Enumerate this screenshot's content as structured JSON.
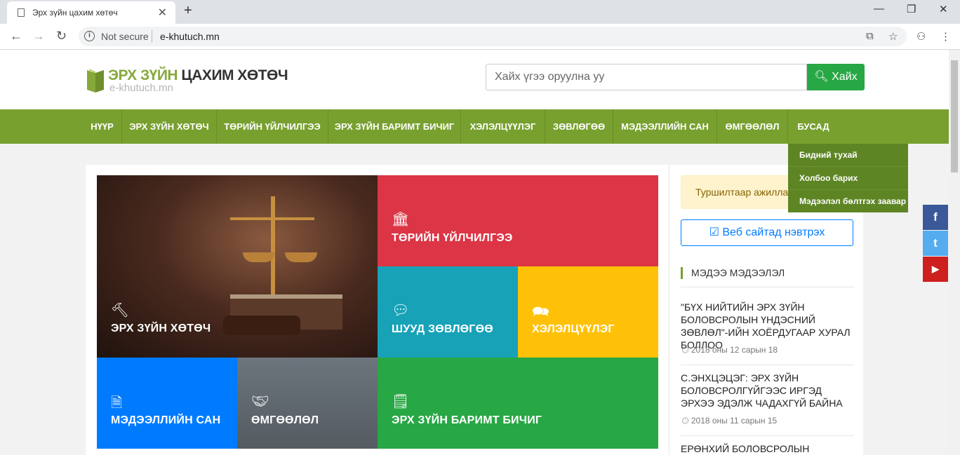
{
  "browser": {
    "tab_title": "Эрх зүйн цахим хөтөч",
    "tab_close": "✕",
    "new_tab": "+",
    "security": "Not secure",
    "url": "e-khutuch.mn",
    "minimize": "—",
    "maximize": "❐",
    "close": "✕"
  },
  "header": {
    "logo_green": "ЭРХ ЗҮЙН",
    "logo_dark": " ЦАХИМ ХӨТӨЧ",
    "logo_sub": "e-khutuch.mn",
    "search_placeholder": "Хайх үгээ оруулна уу",
    "search_button": "Хайх"
  },
  "nav": {
    "items": [
      "НҮҮР",
      "ЭРХ ЗҮЙН ХӨТӨЧ",
      "ТӨРИЙН ҮЙЛЧИЛГЭЭ",
      "ЭРХ ЗҮЙН БАРИМТ БИЧИГ",
      "ХЭЛЭЛЦҮҮЛЭГ",
      "ЗӨВЛӨГӨӨ",
      "МЭДЭЭЛЛИЙН САН",
      "ӨМГӨӨЛӨЛ",
      "БУСАД"
    ],
    "dropdown": [
      "Бидний тухай",
      "Холбоо барих",
      "Мэдээлэл бөлтгэх заавар"
    ]
  },
  "tiles": {
    "law": "ЭРХ ЗҮЙН ХӨТӨЧ",
    "state": "ТӨРИЙН ҮЙЛЧИЛГЭЭ",
    "consult": "ШУУД ЗӨВЛӨГӨӨ",
    "discuss": "ХЭЛЭЛЦҮҮЛЭГ",
    "info": "МЭДЭЭЛЛИЙН САН",
    "guard": "ӨМГӨӨЛӨЛ",
    "docs": "ЭРХ ЗҮЙН БАРИМТ БИЧИГ"
  },
  "sidebar": {
    "alert": "Туршилтаар ажилла",
    "login_button": "Веб сайтад нэвтрэх",
    "news_heading": "МЭДЭЭ МЭДЭЭЛЭЛ",
    "news": [
      {
        "title": "\"БҮХ НИЙТИЙН ЭРХ ЗҮЙН БОЛОВСРОЛЫН ҮНДЭСНИЙ ЗӨВЛӨЛ\"-ИЙН ХОЁРДУГААР ХУРАЛ БОЛЛОО",
        "date": "2018 оны 12 сарын 18"
      },
      {
        "title": "С.ЭНХЦЭЦЭГ: ЭРХ ЗҮЙН БОЛОВСРОЛГҮЙГЭЭС ИРГЭД ЭРХЭЭ ЭДЭЛЖ ЧАДАХГҮЙ БАЙНА",
        "date": "2018 оны 11 сарын 15"
      },
      {
        "title": "ЕРӨНХИЙ БОЛОВСРОЛЫН СУРГУУЛИЙН",
        "date": ""
      }
    ]
  },
  "social": {
    "facebook": "f",
    "twitter": "t",
    "youtube": "▶"
  },
  "colors": {
    "nav": "#78a02f",
    "search": "#28a745",
    "red": "#dc3545",
    "teal": "#17a2b8",
    "yellow": "#ffc107",
    "blue": "#007bff",
    "gray": "#6c757d"
  }
}
